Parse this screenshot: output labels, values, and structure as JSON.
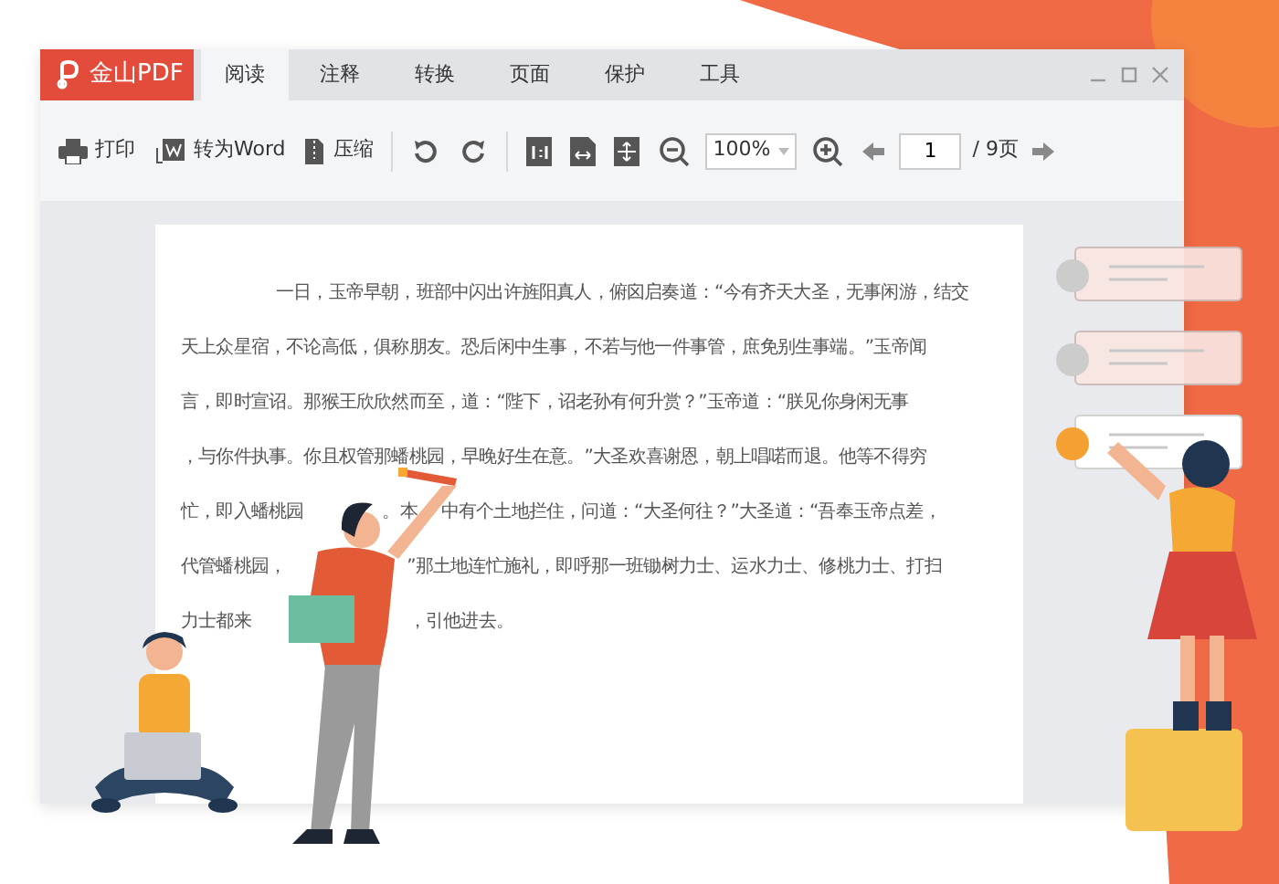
{
  "app": {
    "logo": "金山PDF"
  },
  "tabs": [
    {
      "label": "阅读",
      "selected": true
    },
    {
      "label": "注释",
      "selected": false
    },
    {
      "label": "转换",
      "selected": false
    },
    {
      "label": "页面",
      "selected": false
    },
    {
      "label": "保护",
      "selected": false
    },
    {
      "label": "工具",
      "selected": false
    }
  ],
  "toolbar": {
    "print": "打印",
    "to_word": "转为Word",
    "compress": "压缩",
    "zoom": "100%",
    "page": "1",
    "page_total": "/ 9页"
  },
  "document": {
    "lines": [
      {
        "segments": [
          "一日，玉帝早朝，班部中闪出许旌阳真人，俯囟启奏道：“今有齐天大圣，无事闲游，结交"
        ]
      },
      {
        "segments": [
          "天上众星宿，不论高低，俱称朋友。恐后闲中生事，不若与他一件事管，庶免别生事端。”玉帝闻"
        ]
      },
      {
        "segments": [
          "言，即时宣诏。那猴王欣欣然而至，道：“陛下，诏老孙有何升赏？”玉帝道：“朕见你身闲无事"
        ]
      },
      {
        "segments": [
          "，与你件执事。你且权管那蟠桃园，早晚好生在意。”大圣欢喜谢恩，朝上唱喏而退。他等不得穷"
        ]
      },
      {
        "segments": [
          "忙，即入蟠桃园",
          "。本",
          "中有个土地拦住，问道：“大圣何往？”大圣道：“吾奉玉帝点差，"
        ]
      },
      {
        "segments": [
          "代管蟠桃园，",
          "”那土地连忙施礼，即呼那一班锄树力士、运水力士、修桃力士、打扫"
        ]
      },
      {
        "segments": [
          "力士都来",
          "，引他进去。"
        ]
      }
    ]
  },
  "side_cards": [
    {
      "color": "#cccccc"
    },
    {
      "color": "#cccccc"
    },
    {
      "color": "#f5a033"
    }
  ]
}
